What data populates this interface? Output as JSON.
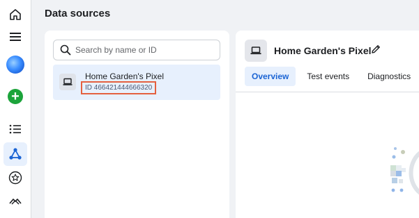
{
  "page": {
    "title": "Data sources"
  },
  "rail": {
    "icons": [
      "home-icon",
      "menu-icon",
      "account-avatar",
      "create-icon",
      "list-icon",
      "events-manager-icon",
      "star-icon",
      "partner-icon"
    ]
  },
  "search": {
    "placeholder": "Search by name or ID",
    "value": ""
  },
  "sources": [
    {
      "name": "Home Garden's Pixel",
      "id_text": "ID 466421444666320",
      "icon": "computer-icon",
      "selected": true
    }
  ],
  "detail": {
    "title": "Home Garden's Pixel",
    "tabs": [
      {
        "label": "Overview",
        "active": true
      },
      {
        "label": "Test events",
        "active": false
      },
      {
        "label": "Diagnostics",
        "active": false
      }
    ]
  },
  "colors": {
    "accent": "#1b64d4",
    "highlight_border": "#e4603f",
    "selected_bg": "#e7f0fd"
  }
}
